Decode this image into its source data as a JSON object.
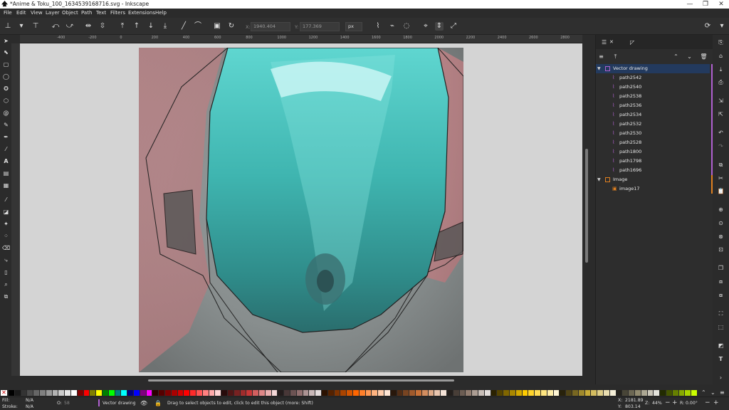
{
  "window": {
    "title": "*Anime & Toku_100_1634539168716.svg - Inkscape",
    "minimize": "—",
    "maximize": "❐",
    "close": "✕"
  },
  "menu": [
    "File",
    "Edit",
    "View",
    "Layer",
    "Object",
    "Path",
    "Text",
    "Filters",
    "Extensions",
    "Help"
  ],
  "toolcontrols": {
    "x_label": "X:",
    "x_value": "1940.404",
    "y_label": "Y:",
    "y_value": "177.369",
    "unit": "px"
  },
  "ruler": {
    "ticks": [
      "-400",
      "-200",
      "0",
      "200",
      "400",
      "600",
      "800",
      "1000",
      "1200",
      "1400",
      "1600",
      "1800",
      "2000",
      "2200",
      "2400",
      "2600",
      "2800"
    ]
  },
  "objects_panel": {
    "tab_objects_icon": "layers-icon",
    "tab_close": "✕",
    "groups": [
      {
        "label": "Vector drawing",
        "expanded": true,
        "selected": true,
        "color": "#b060d0",
        "children": [
          "path2542",
          "path2540",
          "path2538",
          "path2536",
          "path2534",
          "path2532",
          "path2530",
          "path2528",
          "path1800",
          "path1798",
          "path1696"
        ]
      },
      {
        "label": "Image",
        "expanded": true,
        "selected": false,
        "color": "#e08020",
        "children": [
          "image17"
        ]
      }
    ]
  },
  "status": {
    "fill_label": "Fill:",
    "fill_value": "N/A",
    "stroke_label": "Stroke:",
    "stroke_value": "N/A",
    "opacity_label": "O:",
    "opacity_value": "58",
    "layer_name": "Vector drawing",
    "message": "Drag to select objects to edit, click to edit this object (more: Shift)",
    "x_label": "X:",
    "x_value": "2181.89",
    "y_label": "Y:",
    "y_value": "803.14",
    "zoom_label": "Z:",
    "zoom_value": "44%",
    "rotate_label": "R:",
    "rotate_value": "0.00°"
  },
  "colors": {
    "accent_selected": "#233a5e",
    "vector_layer": "#b060d0",
    "image_layer": "#e08020"
  }
}
